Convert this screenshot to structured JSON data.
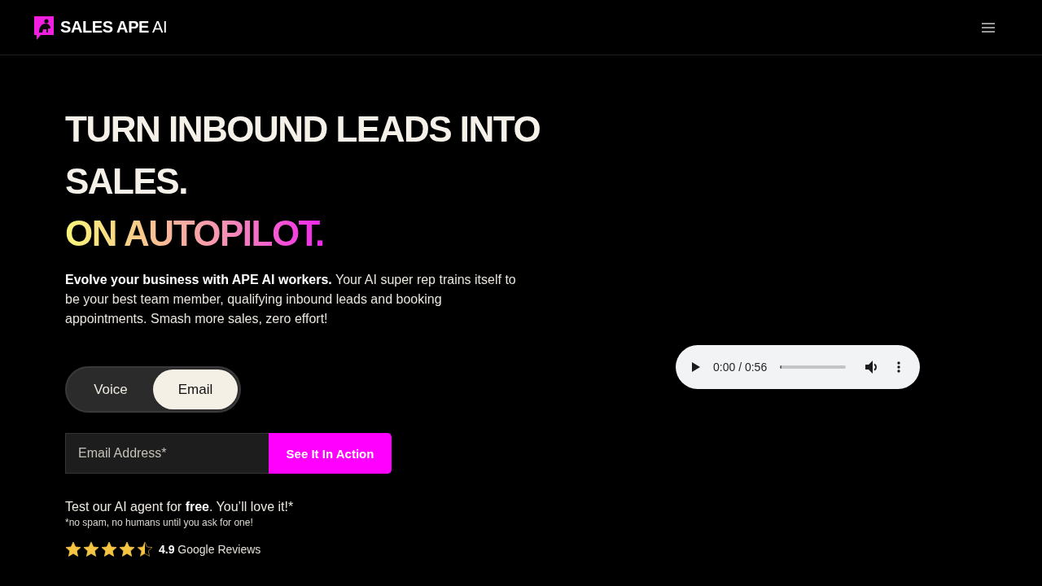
{
  "header": {
    "logo": {
      "text": "**SALES APE** AI"
    }
  },
  "hero": {
    "headline": {
      "text": "TURN INBOUND LEADS INTO SALES.",
      "accent": "ON AUTOPILOT."
    },
    "intro": "**Evolve your business with APE AI workers.** Your AI super rep trains itself to be your best team member, qualifying inbound leads and booking appointments. Smash more sales, zero effort!",
    "mode_toggle": {
      "options": [
        {
          "label": "Voice",
          "selected": false
        },
        {
          "label": "Email",
          "selected": true
        }
      ]
    },
    "signup_form": {
      "email": {
        "placeholder": "Email Address*"
      },
      "submit": "See It In Action"
    },
    "offer": "Test our AI agent for **free**. You’ll love it!*",
    "disclaimer": "*no spam, no humans until you ask for one!",
    "rating": {
      "stars": 4.5,
      "text": "**4.9** Google Reviews"
    }
  },
  "audio_player": {
    "time": "0:00 / 0:56",
    "level": 0
  }
}
